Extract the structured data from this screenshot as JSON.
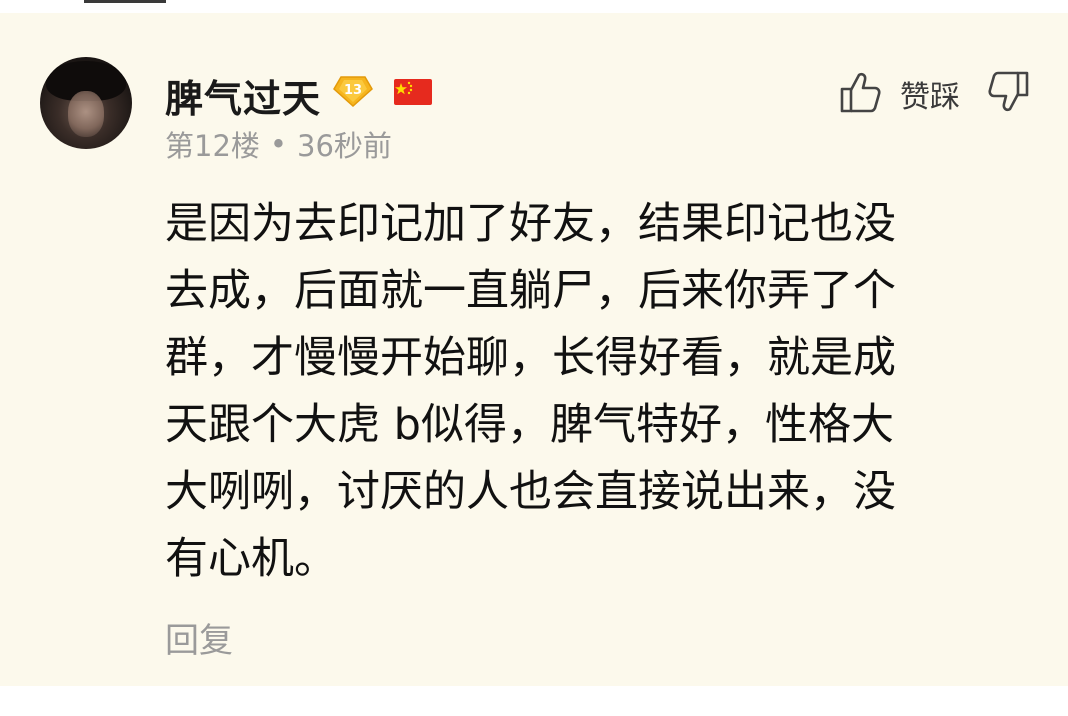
{
  "comment": {
    "author": "脾气过天",
    "level": "13",
    "flag_icon": "china-flag-icon",
    "floor": "第12楼",
    "separator": "•",
    "time": "36秒前",
    "like_label": "赞踩",
    "text": "是因为去印记加了好友，结果印记也没\n去成，后面就一直躺尸，后来你弄了个\n群，才慢慢开始聊，长得好看，就是成\n天跟个大虎 b似得，脾气特好，性格大\n大咧咧，讨厌的人也会直接说出来，没\n有心机。",
    "reply_label": "回复"
  },
  "colors": {
    "card_background": "#fcf9ec",
    "badge_gold": "#f6b51e",
    "flag_red": "#e62a1e",
    "flag_star": "#ffde00",
    "muted_text": "#9a9a9a"
  }
}
